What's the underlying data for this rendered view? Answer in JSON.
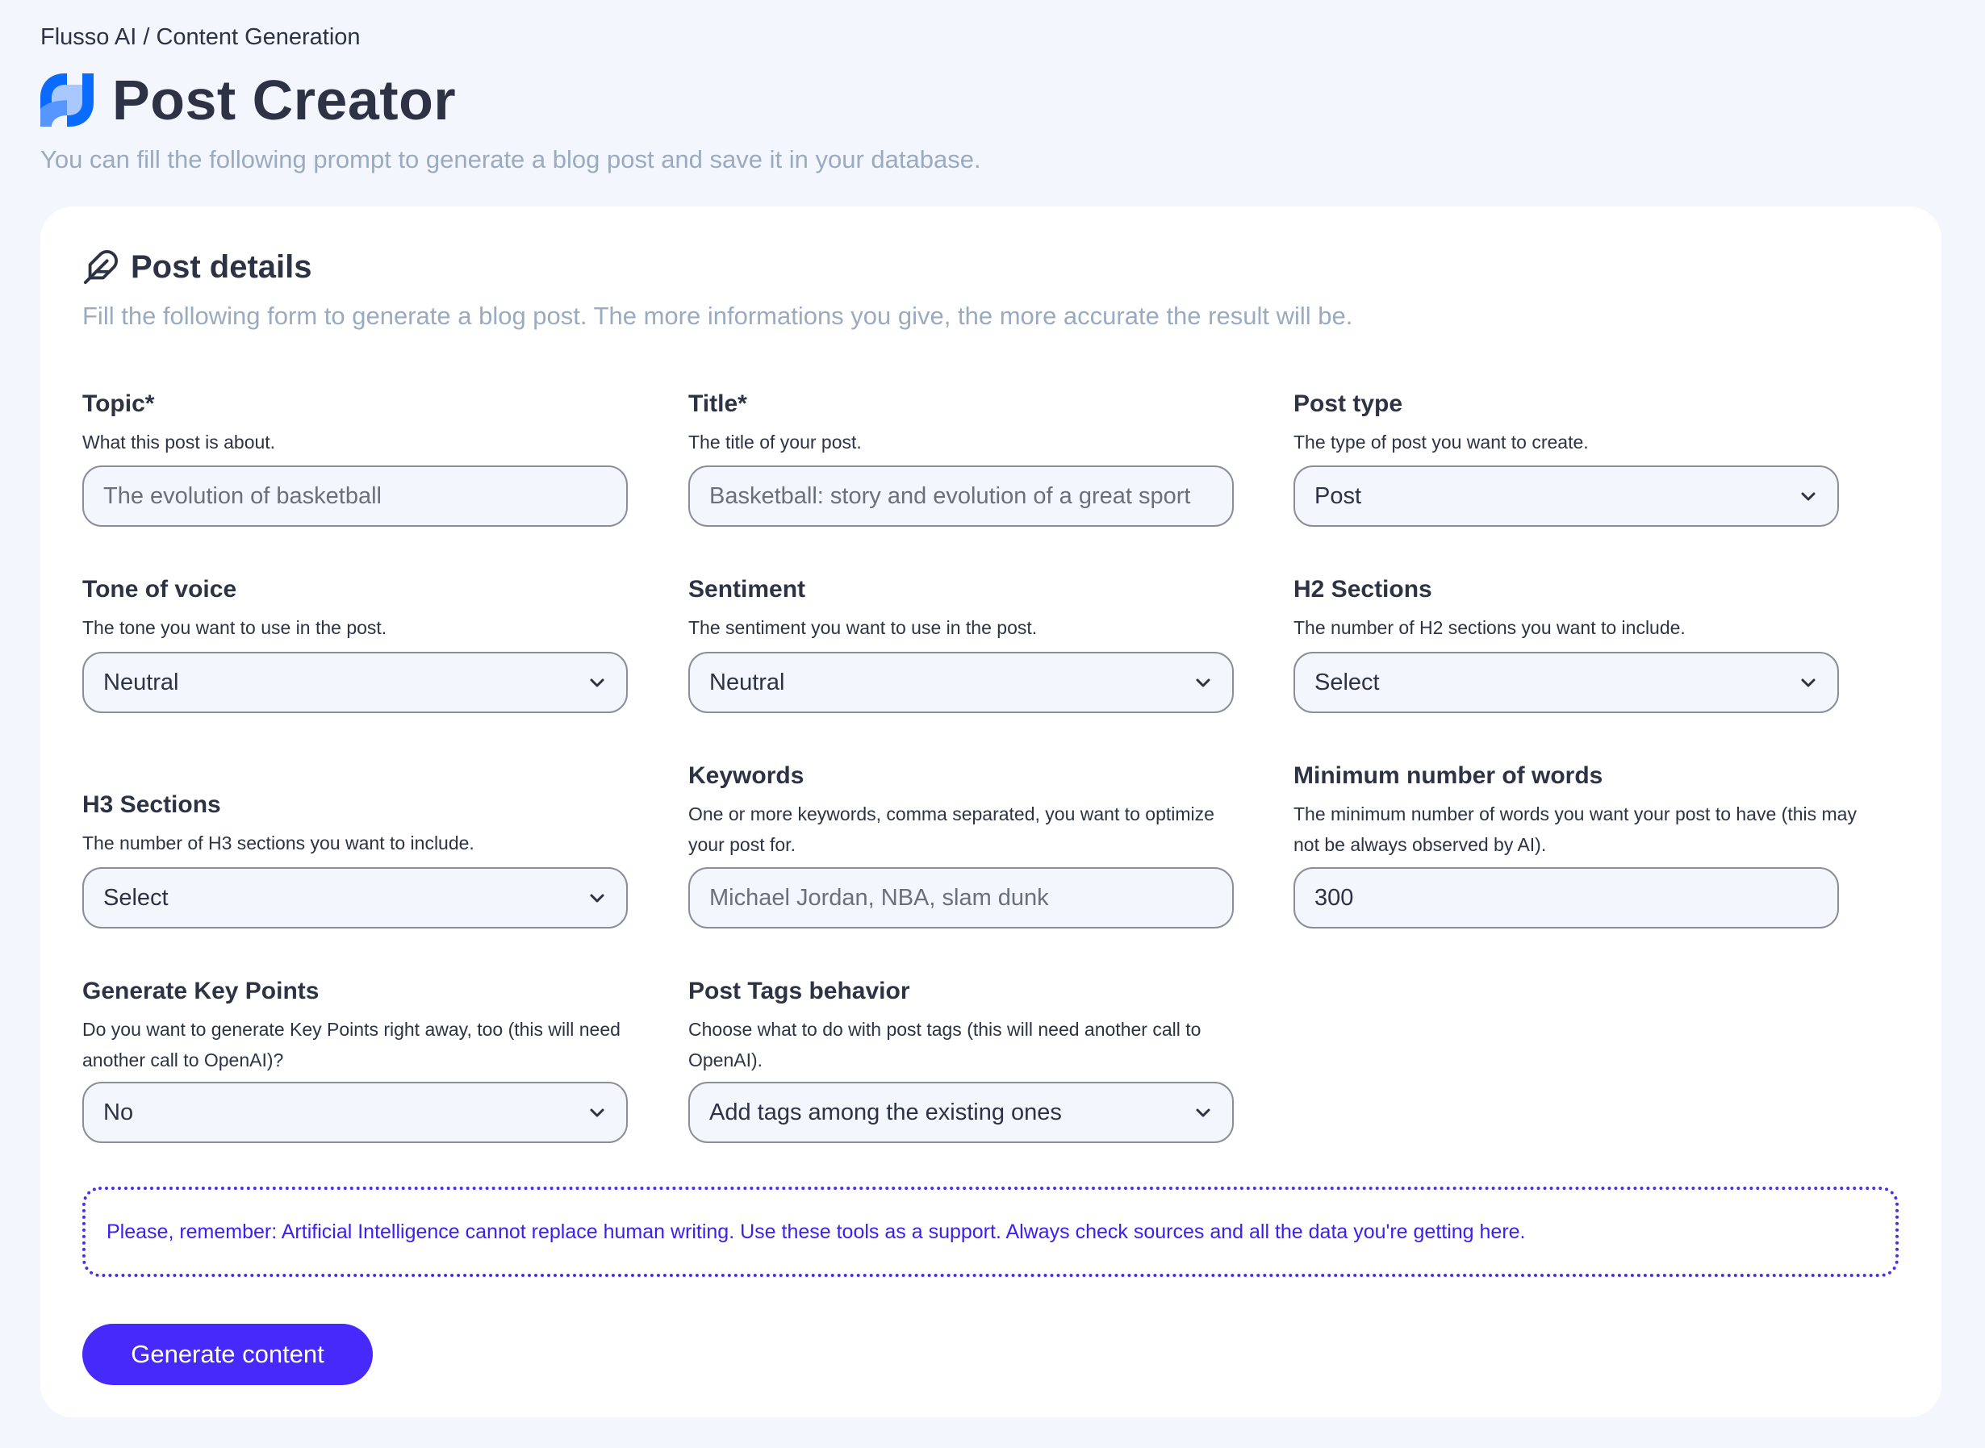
{
  "breadcrumb": "Flusso AI / Content Generation",
  "header": {
    "title": "Post Creator",
    "subtitle": "You can fill the following prompt to generate a blog post and save it in your database.",
    "logo_icon": "flusso-logo-icon"
  },
  "card": {
    "icon": "feather-icon",
    "title": "Post details",
    "description": "Fill the following form to generate a blog post. The more informations you give, the more accurate the result will be."
  },
  "fields": {
    "topic": {
      "label": "Topic*",
      "help": "What this post is about.",
      "placeholder": "The evolution of basketball",
      "value": ""
    },
    "title": {
      "label": "Title*",
      "help": "The title of your post.",
      "placeholder": "Basketball: story and evolution of a great sport",
      "value": ""
    },
    "post_type": {
      "label": "Post type",
      "help": "The type of post you want to create.",
      "selected": "Post"
    },
    "tone": {
      "label": "Tone of voice",
      "help": "The tone you want to use in the post.",
      "selected": "Neutral"
    },
    "sentiment": {
      "label": "Sentiment",
      "help": "The sentiment you want to use in the post.",
      "selected": "Neutral"
    },
    "h2": {
      "label": "H2 Sections",
      "help": "The number of H2 sections you want to include.",
      "selected": "Select"
    },
    "h3": {
      "label": "H3 Sections",
      "help": "The number of H3 sections you want to include.",
      "selected": "Select"
    },
    "keywords": {
      "label": "Keywords",
      "help": "One or more keywords, comma separated, you want to optimize your post for.",
      "placeholder": "Michael Jordan, NBA, slam dunk",
      "value": ""
    },
    "min_words": {
      "label": "Minimum number of words",
      "help": "The minimum number of words you want your post to have (this may not be always observed by AI).",
      "value": "300"
    },
    "key_points": {
      "label": "Generate Key Points",
      "help": "Do you want to generate Key Points right away, too (this will need another call to OpenAI)?",
      "selected": "No"
    },
    "tags": {
      "label": "Post Tags behavior",
      "help": "Choose what to do with post tags (this will need another call to OpenAI).",
      "selected": "Add tags among the existing ones"
    }
  },
  "notice": "Please, remember: Artificial Intelligence cannot replace human writing. Use these tools as a support. Always check sources and all the data you're getting here.",
  "generate_button": "Generate content",
  "colors": {
    "accent": "#4629fb",
    "notice_text": "#3b20f0",
    "background": "#f3f6fd",
    "muted_text": "#9aabc0",
    "logo_blue": "#0a6cff"
  }
}
